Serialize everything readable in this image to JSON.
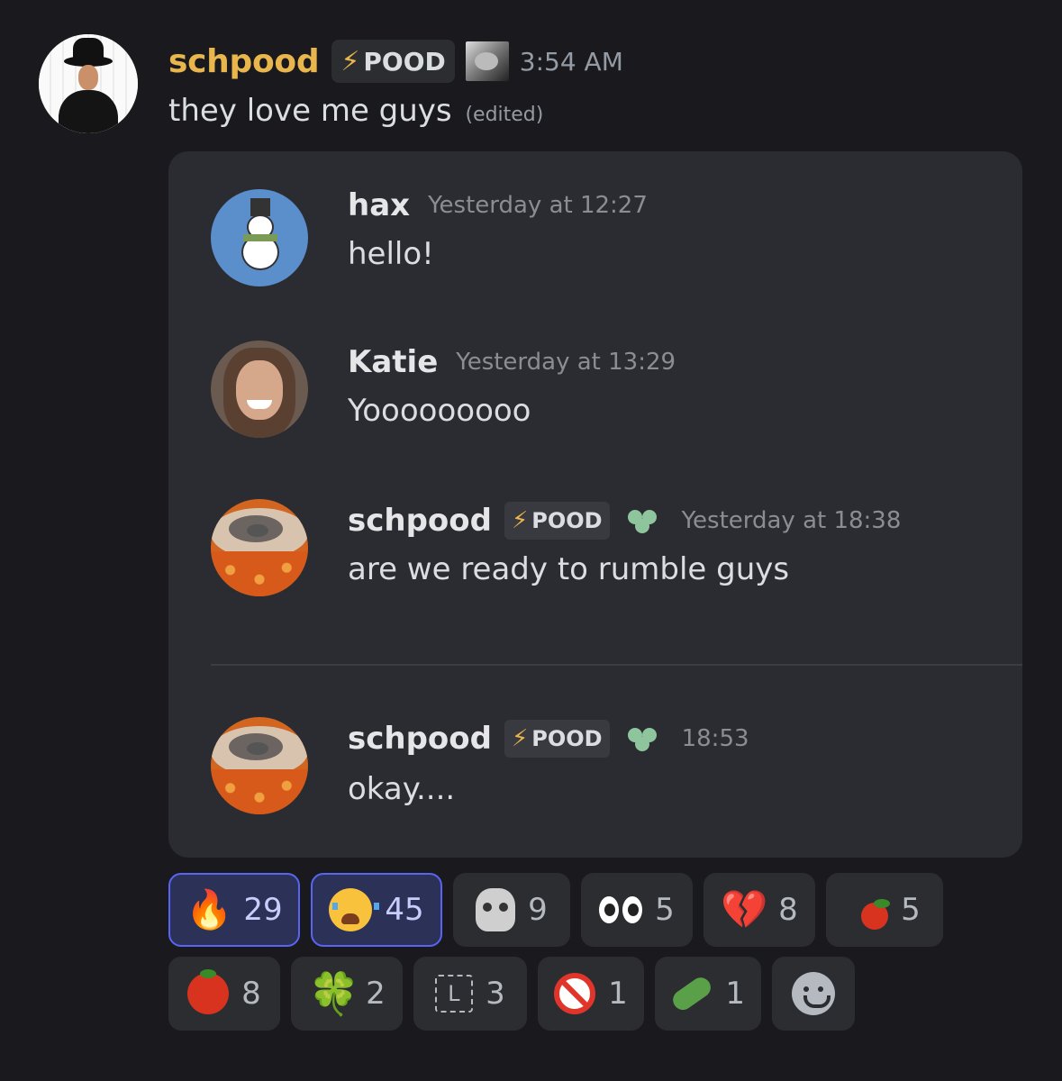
{
  "message": {
    "username": "schpood",
    "tag": "POOD",
    "time": "3:54 AM",
    "text": "they love me guys",
    "edited": "(edited)"
  },
  "quoted": [
    {
      "name": "hax",
      "time": "Yesterday at 12:27",
      "text": "hello!"
    },
    {
      "name": "Katie",
      "time": "Yesterday at 13:29",
      "text": "Yooooooooo"
    },
    {
      "name": "schpood",
      "tag": "POOD",
      "time": "Yesterday at 18:38",
      "text": "are we ready to rumble guys"
    },
    {
      "name": "schpood",
      "tag": "POOD",
      "time": "18:53",
      "text": "okay...."
    }
  ],
  "reactions": [
    {
      "emoji": "fire",
      "count": "29",
      "active": true
    },
    {
      "emoji": "loudly-crying-face",
      "count": "45",
      "active": true
    },
    {
      "emoji": "skull",
      "count": "9",
      "active": false
    },
    {
      "emoji": "eyes",
      "count": "5",
      "active": false
    },
    {
      "emoji": "broken-heart",
      "count": "8",
      "active": false
    },
    {
      "emoji": "tomato-custom",
      "count": "5",
      "active": false
    },
    {
      "emoji": "tomato",
      "count": "8",
      "active": false
    },
    {
      "emoji": "four-leaf-clover",
      "count": "2",
      "active": false
    },
    {
      "emoji": "letter-l",
      "count": "3",
      "active": false
    },
    {
      "emoji": "prohibited",
      "count": "1",
      "active": false
    },
    {
      "emoji": "cucumber",
      "count": "1",
      "active": false
    },
    {
      "emoji": "add-reaction",
      "count": "",
      "active": false
    }
  ],
  "glyphs": {
    "bolt": "⚡",
    "fire": "🔥",
    "broken_heart": "💔",
    "clover": "🍀",
    "letter_l": "L"
  },
  "colors": {
    "username": "#e8b64c",
    "active_border": "#5865f2",
    "background": "#1a1a1e",
    "embed": "#2b2c31"
  }
}
